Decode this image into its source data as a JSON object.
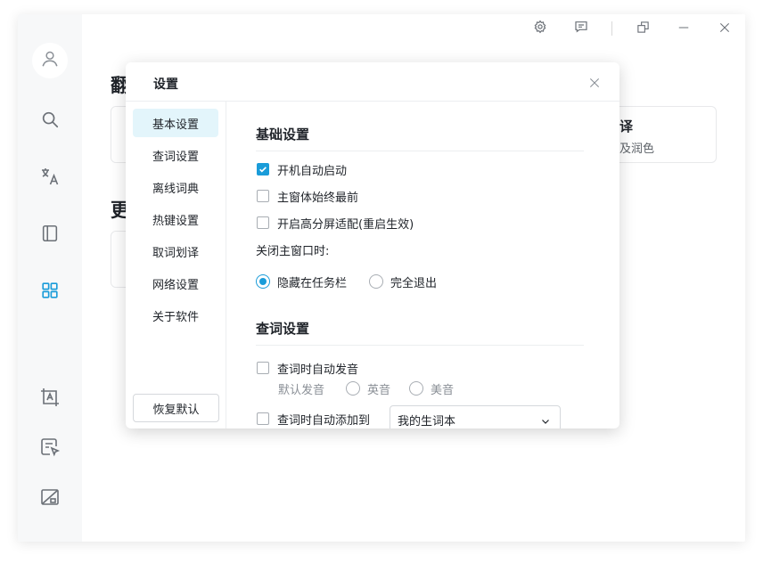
{
  "colors": {
    "accent": "#1a9cd9",
    "nav_active_bg": "#e3f5fb",
    "rail_bg": "#f7f8f9"
  },
  "rail": {
    "items": [
      {
        "name": "user-avatar",
        "icon": "user-icon"
      },
      {
        "name": "search",
        "icon": "search-icon"
      },
      {
        "name": "translate",
        "icon": "translate-icon"
      },
      {
        "name": "book",
        "icon": "book-icon"
      },
      {
        "name": "apps",
        "icon": "grid-icon",
        "active": true
      },
      {
        "name": "screenshot-translate",
        "icon": "crop-text-icon"
      },
      {
        "name": "select-translate",
        "icon": "cursor-select-icon"
      },
      {
        "name": "no-screenshot",
        "icon": "screen-off-icon"
      }
    ]
  },
  "titlebar": {
    "icons": [
      "gear-icon",
      "feedback-icon",
      "restore-icon",
      "minimize-icon",
      "close-icon"
    ]
  },
  "background": {
    "section1_title": "翻",
    "section2_title": "更",
    "card_title": "译",
    "card_desc": "及润色"
  },
  "dialog": {
    "title": "设置",
    "nav": [
      {
        "label": "基本设置",
        "active": true
      },
      {
        "label": "查词设置"
      },
      {
        "label": "离线词典"
      },
      {
        "label": "热键设置"
      },
      {
        "label": "取词划译"
      },
      {
        "label": "网络设置"
      },
      {
        "label": "关于软件"
      }
    ],
    "reset_label": "恢复默认",
    "basic": {
      "title": "基础设置",
      "auto_start": {
        "label": "开机自动启动",
        "checked": true
      },
      "always_top": {
        "label": "主窗体始终最前",
        "checked": false
      },
      "hidpi": {
        "label": "开启高分屏适配(重启生效)",
        "checked": false
      },
      "close_label": "关闭主窗口时:",
      "close_options": [
        {
          "label": "隐藏在任务栏",
          "checked": true
        },
        {
          "label": "完全退出",
          "checked": false
        }
      ]
    },
    "lookup": {
      "title": "查词设置",
      "auto_pronounce": {
        "label": "查词时自动发音",
        "checked": false
      },
      "default_voice_label": "默认发音",
      "voice_options": [
        {
          "label": "英音",
          "checked": false
        },
        {
          "label": "美音",
          "checked": false
        }
      ],
      "auto_add": {
        "label": "查词时自动添加到",
        "checked": false
      },
      "wordbook_value": "我的生词本"
    }
  }
}
